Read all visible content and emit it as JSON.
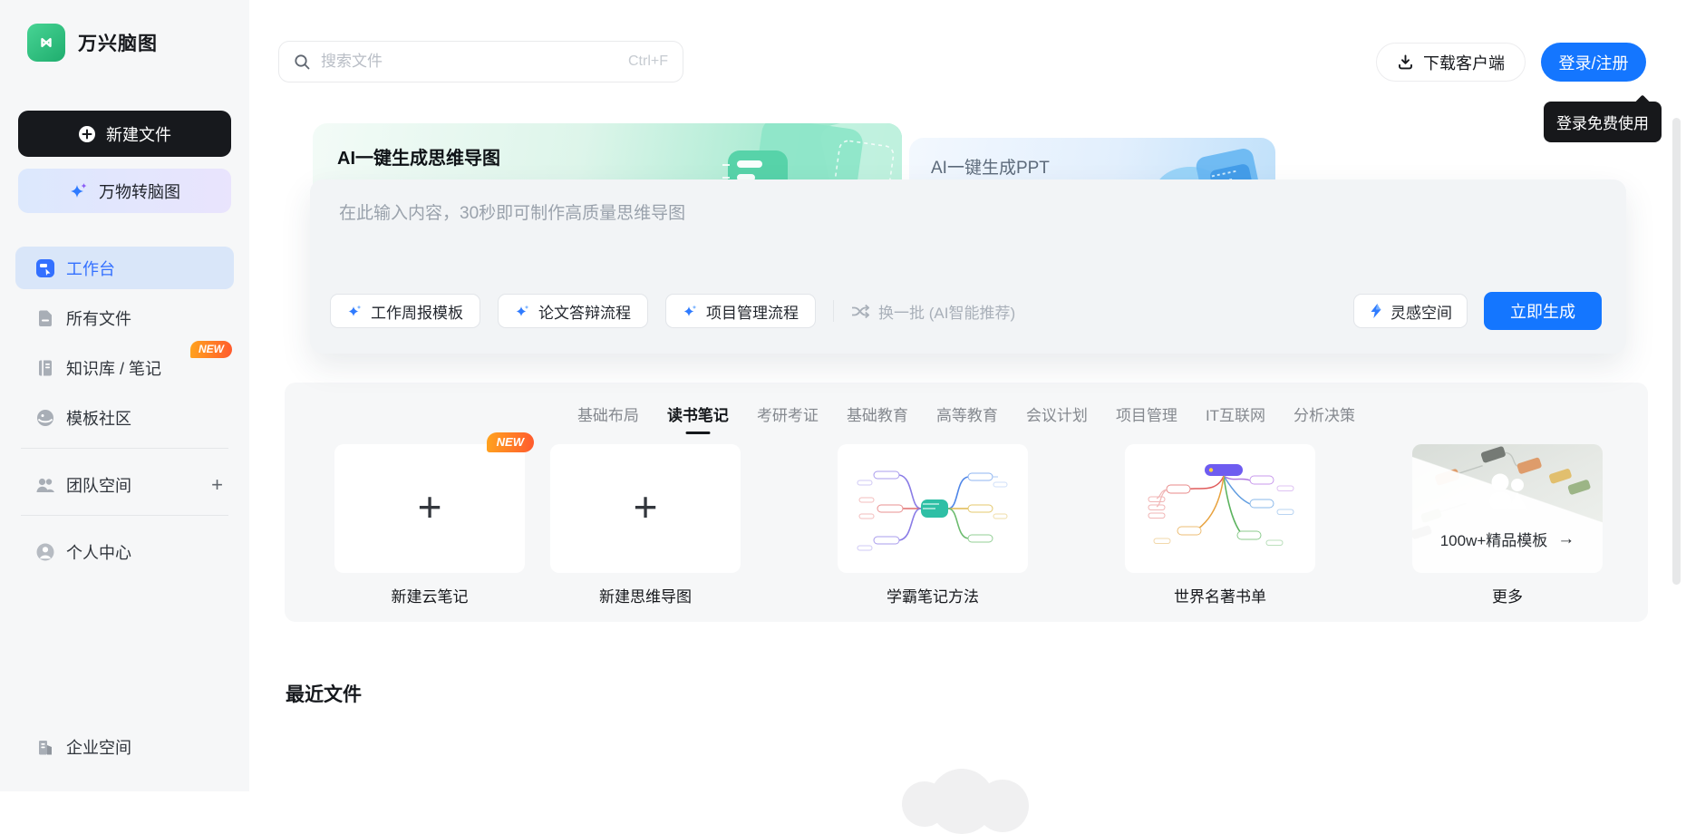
{
  "app": {
    "title": "万兴脑图"
  },
  "sidebar": {
    "new_file_label": "新建文件",
    "convert_label": "万物转脑图",
    "items": [
      {
        "label": "工作台"
      },
      {
        "label": "所有文件"
      },
      {
        "label": "知识库 / 笔记",
        "badge": "NEW"
      },
      {
        "label": "模板社区"
      },
      {
        "label": "团队空间",
        "action": "+"
      },
      {
        "label": "个人中心"
      }
    ],
    "enterprise_label": "企业空间"
  },
  "topbar": {
    "search_placeholder": "搜索文件",
    "search_shortcut": "Ctrl+F",
    "download_label": "下载客户端",
    "login_label": "登录/注册",
    "login_tooltip": "登录免费使用"
  },
  "ai_banner": {
    "mindmap_title": "AI一键生成思维导图",
    "ppt_title": "AI一键生成PPT",
    "input_placeholder": "在此输入内容，30秒即可制作高质量思维导图",
    "prompt_chips": [
      "工作周报模板",
      "论文答辩流程",
      "项目管理流程"
    ],
    "refresh_label": "换一批 (AI智能推荐)",
    "inspiration_label": "灵感空间",
    "generate_label": "立即生成"
  },
  "templates": {
    "tabs": [
      "基础布局",
      "读书笔记",
      "考研考证",
      "基础教育",
      "高等教育",
      "会议计划",
      "项目管理",
      "IT互联网",
      "分析决策"
    ],
    "active_tab": "读书笔记",
    "create_plus": "+",
    "cards": [
      {
        "label": "新建云笔记",
        "badge": "NEW"
      },
      {
        "label": "新建思维导图"
      },
      {
        "label": "学霸笔记方法"
      },
      {
        "label": "世界名著书单"
      },
      {
        "label": "更多",
        "overlay_text": "100w+精品模板",
        "overlay_arrow": "→"
      }
    ]
  },
  "recent": {
    "title": "最近文件"
  },
  "colors": {
    "primary_blue": "#1476ff",
    "brand_green": "#2fbe7d",
    "badge_orange": "#ff7a2e",
    "active_item_blue": "#3370ff"
  }
}
